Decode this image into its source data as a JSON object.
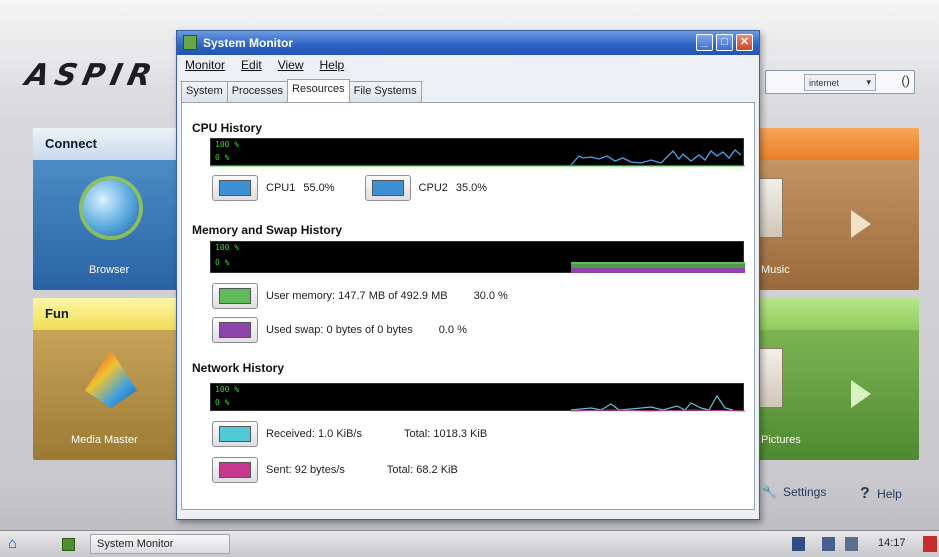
{
  "desktop": {
    "brand": "ASPIR",
    "search": {
      "dropdown": "internet",
      "go": "()"
    },
    "tiles": {
      "internet": {
        "header": "Connect",
        "label": "Browser"
      },
      "fun": {
        "header": "Fun",
        "label": "Media Master"
      },
      "media": {
        "label": "Music"
      },
      "photos": {
        "label": "Pictures"
      }
    },
    "settings_label": "Settings",
    "help_label": "Help"
  },
  "taskbar": {
    "task_label": "System Monitor",
    "clock": "14:17"
  },
  "window": {
    "title": "System Monitor",
    "menus": [
      "Monitor",
      "Edit",
      "View",
      "Help"
    ],
    "tabs": [
      "System",
      "Processes",
      "Resources",
      "File Systems"
    ],
    "active_tab": "Resources",
    "buttons": {
      "minimize": "_",
      "maximize": "□",
      "close": "✕"
    },
    "cpu": {
      "title": "CPU History",
      "ylabels": [
        "100 %",
        "0 %"
      ],
      "legend": [
        {
          "label": "CPU1",
          "value": "55.0%",
          "color": "#3f8fd6"
        },
        {
          "label": "CPU2",
          "value": "35.0%",
          "color": "#3f8fd6"
        }
      ],
      "line_color": "#4da3e8"
    },
    "memory": {
      "title": "Memory and Swap History",
      "ylabels": [
        "100 %",
        "0 %"
      ],
      "user_memory": {
        "text": "User memory: 147.7 MB of 492.9 MB",
        "percent": "30.0 %",
        "color": "#5fbb5c"
      },
      "used_swap": {
        "text": "Used swap: 0 bytes of 0 bytes",
        "percent": "0.0 %",
        "color": "#8e44ad"
      }
    },
    "network": {
      "title": "Network History",
      "ylabels": [
        "100 %",
        "0 %"
      ],
      "received": {
        "text": "Received: 1.0 KiB/s",
        "total": "Total: 1018.3 KiB",
        "color": "#53c8d6"
      },
      "sent": {
        "text": "Sent: 92 bytes/s",
        "total": "Total: 68.2 KiB",
        "color": "#c8378f"
      }
    }
  }
}
